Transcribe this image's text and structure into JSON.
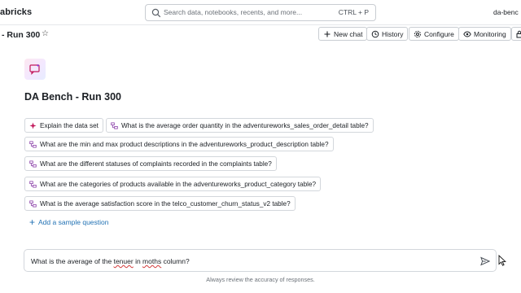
{
  "topbar": {
    "brand": "abricks",
    "search_placeholder": "Search data, notebooks, recents, and more...",
    "search_shortcut": "CTRL + P",
    "user": "da-benc"
  },
  "titlebar": {
    "title": "- Run 300",
    "buttons": {
      "new_chat": "New chat",
      "history": "History",
      "configure": "Configure",
      "monitoring": "Monitoring"
    }
  },
  "main": {
    "space_name": "DA Bench - Run 300",
    "sample_questions": [
      "Explain the data set",
      "What is the average order quantity in the adventureworks_sales_order_detail table?",
      "What are the min and max product descriptions in the adventureworks_product_description table?",
      "What are the different statuses of complaints recorded in the complaints table?",
      "What are the categories of products available in the adventureworks_product_category table?",
      "What is the average satisfaction score in the telco_customer_churn_status_v2 table?"
    ],
    "add_sample": "Add a sample question"
  },
  "chat": {
    "input_parts": [
      "What is the average of the ",
      "tenuer",
      " in ",
      "moths",
      " column?"
    ],
    "disclaimer": "Always review the accuracy of responses."
  },
  "colors": {
    "accent_blue": "#2272b4",
    "sparkle_pink": "#c2185b",
    "border": "#d3d7dc"
  },
  "icons": [
    "search-icon",
    "star-icon",
    "plus-icon",
    "history-icon",
    "gear-icon",
    "eye-icon",
    "sparkle-icon",
    "table-icon",
    "send-icon"
  ]
}
